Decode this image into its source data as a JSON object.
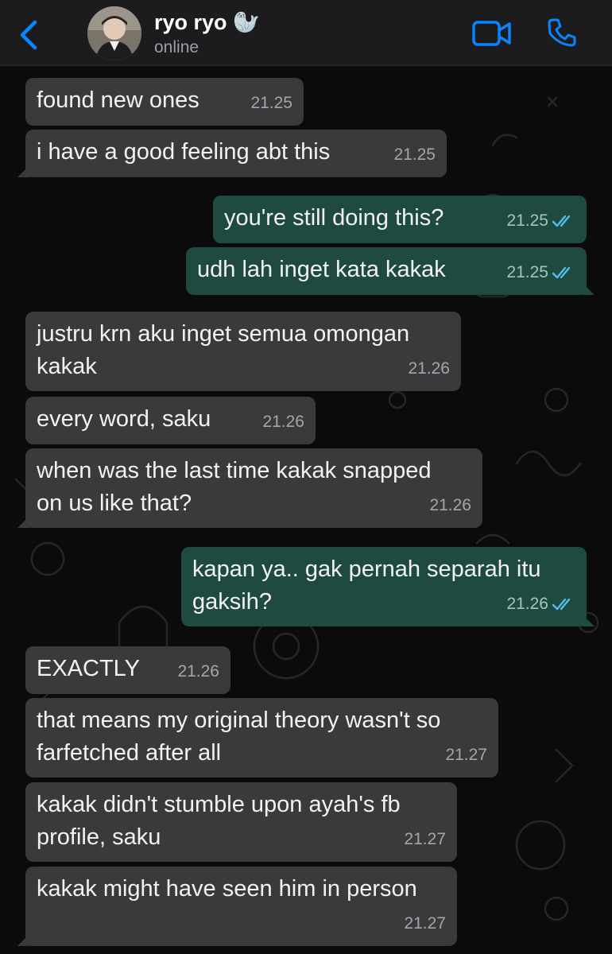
{
  "header": {
    "contact_name": "ryo ryo 🦭",
    "status": "online"
  },
  "messages": [
    {
      "dir": "in",
      "text": "found new ones",
      "time": "21.25"
    },
    {
      "dir": "in",
      "text": "i have a good feeling abt this",
      "time": "21.25"
    },
    {
      "dir": "out",
      "text": "you're still doing this?",
      "time": "21.25"
    },
    {
      "dir": "out",
      "text": "udh lah inget kata kakak",
      "time": "21.25"
    },
    {
      "dir": "in",
      "text": "justru krn aku inget semua omongan\nkakak",
      "time": "21.26"
    },
    {
      "dir": "in",
      "text": "every word, saku",
      "time": "21.26"
    },
    {
      "dir": "in",
      "text": "when was the last time kakak snapped\non us like that?",
      "time": "21.26"
    },
    {
      "dir": "out",
      "text": "kapan ya.. gak pernah separah itu\ngaksih?",
      "time": "21.26"
    },
    {
      "dir": "in",
      "text": "EXACTLY",
      "time": "21.26"
    },
    {
      "dir": "in",
      "text": "that means my original theory wasn't so\nfarfetched after all",
      "time": "21.27"
    },
    {
      "dir": "in",
      "text": "kakak didn't stumble upon ayah's fb\nprofile, saku",
      "time": "21.27"
    },
    {
      "dir": "in",
      "text": "kakak might have seen him in person",
      "time": "21.27"
    }
  ],
  "colors": {
    "incoming_bubble": "#3a3a3c",
    "outgoing_bubble": "#1f4a40",
    "accent": "#0a84ff",
    "read_tick": "#53bdeb"
  },
  "icons": [
    "chevron-left-icon",
    "video-call-icon",
    "phone-icon",
    "double-check-icon"
  ]
}
